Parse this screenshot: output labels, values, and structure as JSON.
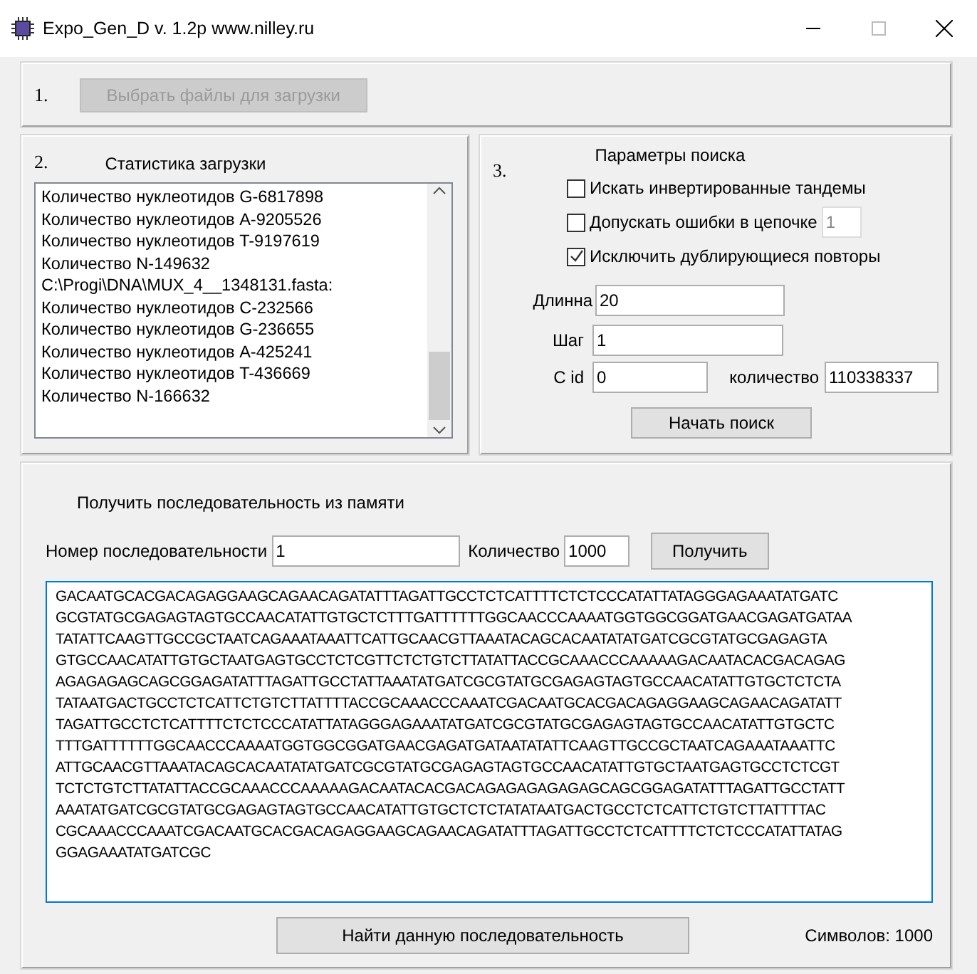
{
  "window": {
    "title": "Expo_Gen_D v. 1.2p  www.nilley.ru"
  },
  "section_1": {
    "number": "1.",
    "select_files_button": {
      "label": "Выбрать файлы для загрузки",
      "disabled": true
    }
  },
  "section_2": {
    "number": "2.",
    "title": "Статистика загрузки",
    "log_lines": [
      "Количество нуклеотидов G-6817898",
      "Количество нуклеотидов A-9205526",
      "Количество нуклеотидов T-9197619",
      "Количество N-149632",
      "C:\\Progi\\DNA\\MUX_4__1348131.fasta:",
      "Количество нуклеотидов C-232566",
      "Количество нуклеотидов G-236655",
      "Количество нуклеотидов A-425241",
      "Количество нуклеотидов T-436669",
      "Количество N-166632"
    ]
  },
  "section_3": {
    "number": "3.",
    "title": "Параметры поиска",
    "options": [
      {
        "label": "Искать инвертированные тандемы",
        "checked": false
      },
      {
        "label": "Допускать ошибки в цепочке",
        "checked": false,
        "value": "1",
        "value_disabled": true
      },
      {
        "label": "Исключить дублирующиеся повторы",
        "checked": true
      }
    ],
    "length": {
      "label": "Длинна",
      "value": "20"
    },
    "step": {
      "label": "Шаг",
      "value": "1"
    },
    "c_id": {
      "label": "C id",
      "value": "0"
    },
    "count": {
      "label": "количество",
      "value": "110338337"
    },
    "start_button": "Начать поиск"
  },
  "section_4": {
    "title": "Получить последовательность из памяти",
    "number_field": {
      "label": "Номер последовательности",
      "value": "1"
    },
    "quantity_field": {
      "label": "Количество",
      "value": "1000"
    },
    "get_button": "Получить",
    "sequence_lines": [
      "GACAATGCACGACAGAGGAAGCAGAACAGATATTTAGATTGCCTCTCATTTTCTCTCCCATATTATAGGGAGAAATATGATC",
      "GCGTATGCGAGAGTAGTGCCAACATATTGTGCTCTTTGATTTTTTGGCAACCCAAAATGGTGGCGGATGAACGAGATGATAA",
      "TATATTCAAGTTGCCGCTAATCAGAAATAAATTCATTGCAACGTTAAATACAGCACAATATATGATCGCGTATGCGAGAGTA",
      "GTGCCAACATATTGTGCTAATGAGTGCCTCTCGTTCTCTGTCTTATATTACCGCAAACCCAAAAAGACAATACACGACAGAG",
      "AGAGAGAGCAGCGGAGATATTTAGATTGCCTATTAAATATGATCGCGTATGCGAGAGTAGTGCCAACATATTGTGCTCTCTA",
      "TATAATGACTGCCTCTCATTCTGTCTTATTTTACCGCAAACCCAAATCGACAATGCACGACAGAGGAAGCAGAACAGATATT",
      "TAGATTGCCTCTCATTTTCTCTCCCATATTATAGGGAGAAATATGATCGCGTATGCGAGAGTAGTGCCAACATATTGTGCTC",
      "TTTGATTTTTTGGCAACCCAAAATGGTGGCGGATGAACGAGATGATAATATATTCAAGTTGCCGCTAATCAGAAATAAATTC",
      "ATTGCAACGTTAAATACAGCACAATATATGATCGCGTATGCGAGAGTAGTGCCAACATATTGTGCTAATGAGTGCCTCTCGT",
      "TCTCTGTCTTATATTACCGCAAACCCAAAAAGACAATACACGACAGAGAGAGAGAGCAGCGGAGATATTTAGATTGCCTATT",
      "AAATATGATCGCGTATGCGAGAGTAGTGCCAACATATTGTGCTCTCTATATAATGACTGCCTCTCATTCTGTCTTATTTTAC",
      "CGCAAACCCAAATCGACAATGCACGACAGAGGAAGCAGAACAGATATTTAGATTGCCTCTCATTTTCTCTCCCATATTATAG",
      "GGAGAAATATGATCGC"
    ],
    "find_button": "Найти данную последовательность",
    "symbols": "Символов: 1000"
  }
}
